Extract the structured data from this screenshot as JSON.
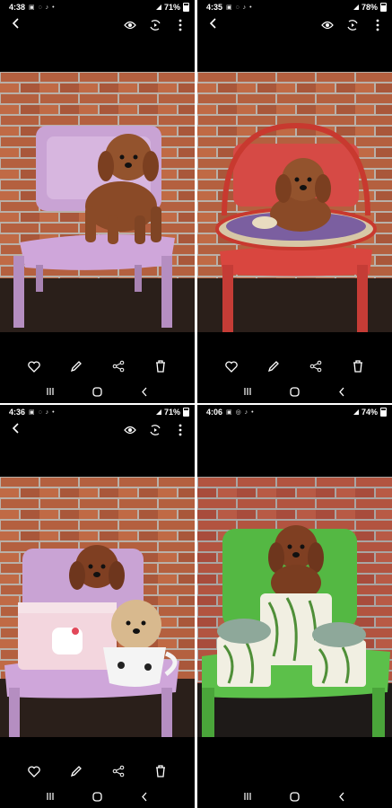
{
  "screens": [
    {
      "status": {
        "time": "4:38",
        "notifications": "▣ ◌ ♪ •",
        "battery": "71%"
      }
    },
    {
      "status": {
        "time": "4:35",
        "notifications": "▣ ◌ ♪ •",
        "battery": "78%"
      }
    },
    {
      "status": {
        "time": "4:36",
        "notifications": "▣ ◌ ♪ •",
        "battery": "71%"
      }
    },
    {
      "status": {
        "time": "4:06",
        "notifications": "▣ ◎ ♪ •",
        "battery": "74%"
      }
    }
  ],
  "icons": {
    "back": "chevron-left-icon",
    "view": "eye-icon",
    "remaster": "remaster-icon",
    "more": "more-vertical-icon",
    "favorite": "heart-icon",
    "edit": "pencil-icon",
    "share": "share-icon",
    "delete": "trash-icon",
    "recents": "recent-apps-icon",
    "home": "home-icon",
    "nav_back": "nav-back-icon"
  },
  "colors": {
    "panel_bg": "#000000",
    "icon": "#ffffff"
  }
}
